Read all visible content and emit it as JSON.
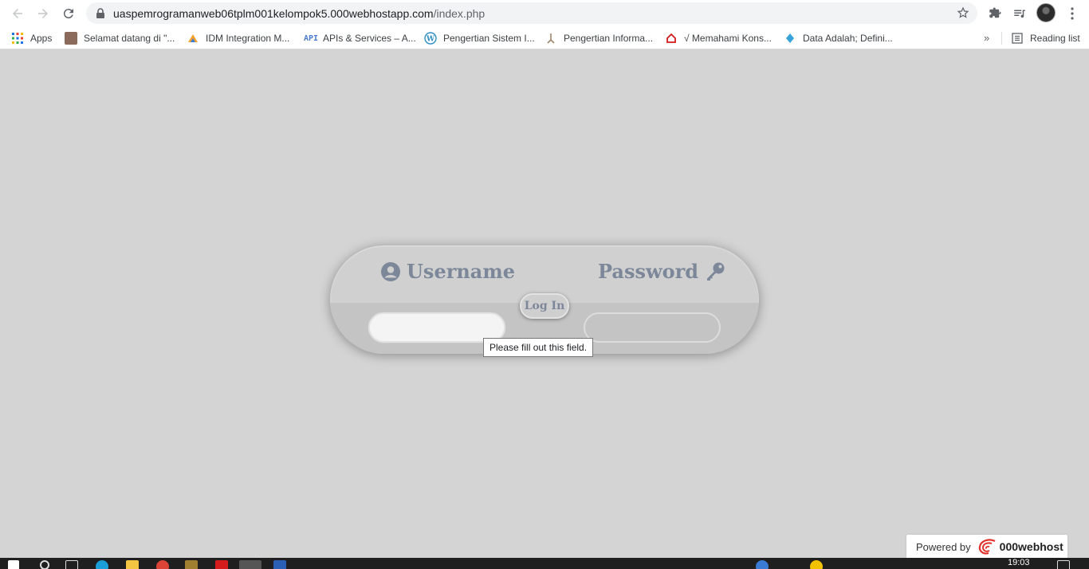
{
  "browser": {
    "url_host": "uaspemrogramanweb06tplm001kelompok5.000webhostapp.com",
    "url_path": "/index.php",
    "bookmarks": [
      {
        "label": "Apps",
        "icon": "apps-grid-icon"
      },
      {
        "label": "Selamat datang di \"...",
        "icon": "site-favicon"
      },
      {
        "label": "IDM Integration M...",
        "icon": "idm-icon"
      },
      {
        "label": "APIs & Services – A...",
        "icon": "api-icon"
      },
      {
        "label": "Pengertian Sistem I...",
        "icon": "wordpress-icon"
      },
      {
        "label": "Pengertian Informa...",
        "icon": "site-favicon"
      },
      {
        "label": "√ Memahami Kons...",
        "icon": "home-icon"
      },
      {
        "label": "Data Adalah; Defini...",
        "icon": "site-favicon"
      }
    ],
    "more_bookmarks": "»",
    "reading_list": "Reading list"
  },
  "login": {
    "username_label": "Username",
    "password_label": "Password",
    "login_button": "Log In",
    "username_value": "",
    "password_value": ""
  },
  "validation_tooltip": "Please fill out this field.",
  "footer": {
    "powered_by": "Powered by",
    "brand": "000webhost"
  },
  "taskbar": {
    "time": "19:03"
  },
  "colors": {
    "page_bg": "#d4d4d4",
    "label_color": "#7c8799",
    "brand_red": "#e0322b"
  }
}
